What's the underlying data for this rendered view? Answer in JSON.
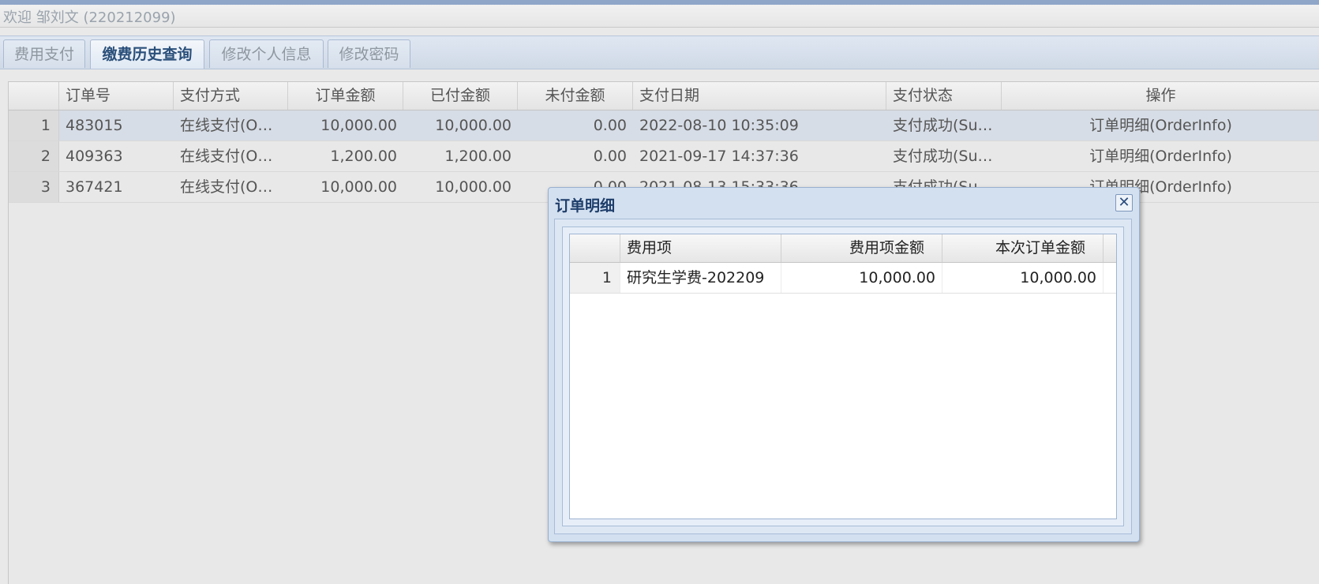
{
  "welcome": "欢迎 邹刘文 (220212099)",
  "tabs": [
    "费用支付",
    "缴费历史查询",
    "修改个人信息",
    "修改密码"
  ],
  "grid": {
    "headers": [
      "订单号",
      "支付方式",
      "订单金额",
      "已付金额",
      "未付金额",
      "支付日期",
      "支付状态",
      "操作"
    ],
    "rows": [
      {
        "num": "1",
        "order": "483015",
        "method": "在线支付(O…",
        "amount": "10,000.00",
        "paid": "10,000.00",
        "unpaid": "0.00",
        "date": "2022-08-10 10:35:09",
        "status": "支付成功(Su…",
        "action": "订单明细(OrderInfo)"
      },
      {
        "num": "2",
        "order": "409363",
        "method": "在线支付(O…",
        "amount": "1,200.00",
        "paid": "1,200.00",
        "unpaid": "0.00",
        "date": "2021-09-17 14:37:36",
        "status": "支付成功(Su…",
        "action": "订单明细(OrderInfo)"
      },
      {
        "num": "3",
        "order": "367421",
        "method": "在线支付(O…",
        "amount": "10,000.00",
        "paid": "10,000.00",
        "unpaid": "0.00",
        "date": "2021-08-13 15:33:36",
        "status": "支付成功(Su…",
        "action": "订单明细(OrderInfo)"
      }
    ]
  },
  "dialog": {
    "title": "订单明细",
    "close_icon": "close-icon",
    "headers": [
      "费用项",
      "费用项金额",
      "本次订单金额"
    ],
    "rows": [
      {
        "num": "1",
        "item": "研究生学费-202209",
        "item_amount": "10,000.00",
        "order_amount": "10,000.00"
      }
    ]
  },
  "colors": {
    "accent": "#2a4f7a",
    "link": "#5a66d6",
    "selected_row": "#d7dde6"
  }
}
